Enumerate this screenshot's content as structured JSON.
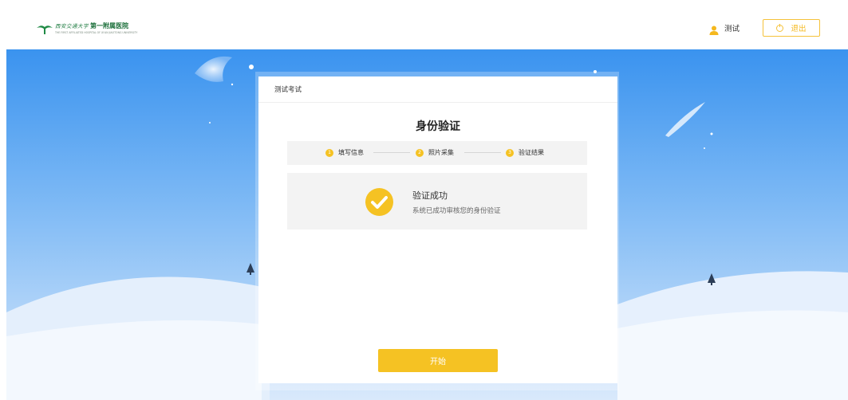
{
  "header": {
    "logo": {
      "calligraphy": "西安交通大学",
      "name": "第一附属医院",
      "english": "THE FIRST AFFILIATED HOSPITAL OF XI'AN JIAOTONG UNIVERSITY"
    },
    "user_name": "测试",
    "logout_label": "退出"
  },
  "card": {
    "exam_name": "测试考试",
    "title": "身份验证",
    "steps": [
      {
        "num": "1",
        "label": "填写信息"
      },
      {
        "num": "2",
        "label": "照片采集"
      },
      {
        "num": "3",
        "label": "验证结果"
      }
    ],
    "result": {
      "title": "验证成功",
      "description": "系统已成功审核您的身份验证"
    },
    "start_label": "开始"
  },
  "colors": {
    "accent": "#f5c223",
    "sky_top": "#3f96f0",
    "sky_bottom": "#cfe3fb",
    "snow": "#eaf3fd"
  }
}
